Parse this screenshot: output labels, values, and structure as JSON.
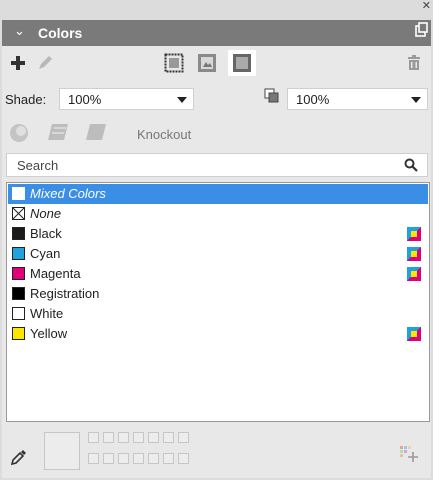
{
  "panel": {
    "title": "Colors"
  },
  "toolbar": {
    "new_icon": "plus-icon",
    "edit_icon": "pencil-icon",
    "frame_icon": "frame-icon",
    "content_icon": "content-icon",
    "text_icon": "text-fill-icon",
    "delete_icon": "trash-icon"
  },
  "shade": {
    "label": "Shade:",
    "value": "100%"
  },
  "opacity": {
    "value": "100%"
  },
  "blend": {
    "knockout_label": "Knockout"
  },
  "search": {
    "placeholder": "Search"
  },
  "colors": [
    {
      "name": "Mixed Colors",
      "swatch": "#ffffff",
      "selected": true,
      "process": false,
      "type": "mixed"
    },
    {
      "name": "None",
      "swatch": "none",
      "selected": false,
      "process": false,
      "type": "none"
    },
    {
      "name": "Black",
      "swatch": "#1a1a1a",
      "selected": false,
      "process": true,
      "type": "color"
    },
    {
      "name": "Cyan",
      "swatch": "#1fa2e0",
      "selected": false,
      "process": true,
      "type": "color"
    },
    {
      "name": "Magenta",
      "swatch": "#e0007a",
      "selected": false,
      "process": true,
      "type": "color"
    },
    {
      "name": "Registration",
      "swatch": "#000000",
      "selected": false,
      "process": false,
      "type": "color"
    },
    {
      "name": "White",
      "swatch": "#ffffff",
      "selected": false,
      "process": false,
      "type": "color"
    },
    {
      "name": "Yellow",
      "swatch": "#ffe600",
      "selected": false,
      "process": true,
      "type": "color"
    }
  ],
  "colors_ui": {
    "accent": "#3b8ee6",
    "titlebar": "#7a7a7a"
  }
}
